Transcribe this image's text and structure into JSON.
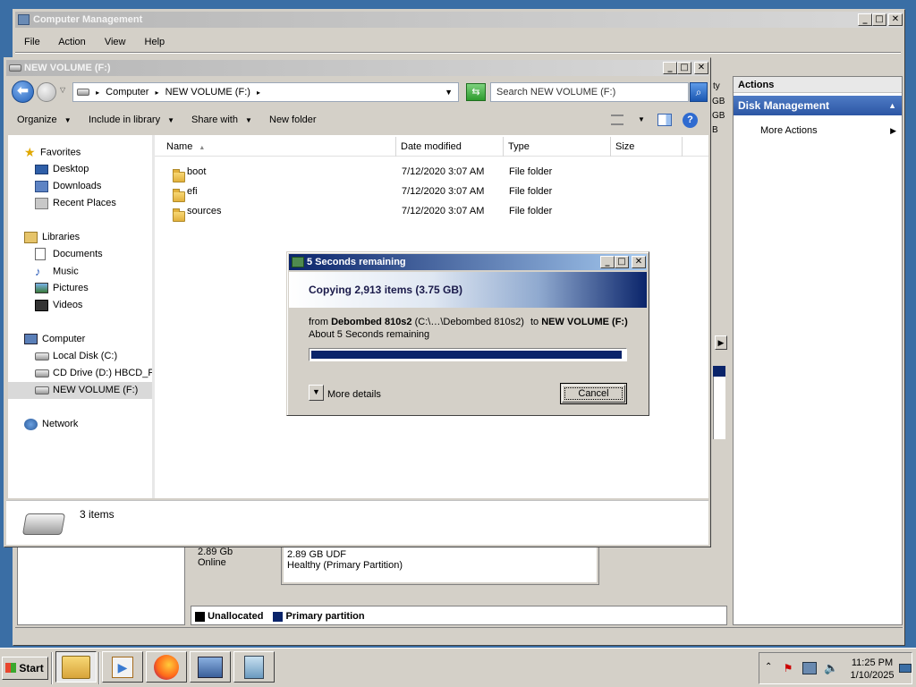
{
  "cm": {
    "title": "Computer Management",
    "menu": [
      "File",
      "Action",
      "View",
      "Help"
    ],
    "actions_title": "Actions",
    "disk_mgmt": "Disk Management",
    "more_actions": "More Actions",
    "volume_size": "2.89 GB UDF",
    "volume_status": "Healthy (Primary Partition)",
    "disk_size": "2.89 Gb",
    "disk_state": "Online",
    "legend_unalloc": "Unallocated",
    "legend_primary": "Primary partition",
    "partial_ty": "ty",
    "partial_gb1": "GB",
    "partial_gb2": "GB"
  },
  "explorer": {
    "title": "NEW VOLUME (F:)",
    "breadcrumb": [
      "Computer",
      "NEW VOLUME (F:)"
    ],
    "search_placeholder": "Search NEW VOLUME (F:)",
    "toolbar": {
      "organize": "Organize",
      "include": "Include in library",
      "share": "Share with",
      "new_folder": "New folder"
    },
    "columns": {
      "name": "Name",
      "date": "Date modified",
      "type": "Type",
      "size": "Size"
    },
    "files": [
      {
        "name": "boot",
        "date": "7/12/2020 3:07 AM",
        "type": "File folder",
        "size": ""
      },
      {
        "name": "efi",
        "date": "7/12/2020 3:07 AM",
        "type": "File folder",
        "size": ""
      },
      {
        "name": "sources",
        "date": "7/12/2020 3:07 AM",
        "type": "File folder",
        "size": ""
      }
    ],
    "nav": {
      "favorites": "Favorites",
      "desktop": "Desktop",
      "downloads": "Downloads",
      "recent": "Recent Places",
      "libraries": "Libraries",
      "documents": "Documents",
      "music": "Music",
      "pictures": "Pictures",
      "videos": "Videos",
      "computer": "Computer",
      "local_disk": "Local Disk (C:)",
      "cd_drive": "CD Drive (D:) HBCD_P",
      "new_volume": "NEW VOLUME (F:)",
      "network": "Network"
    },
    "status_count": "3 items"
  },
  "copy": {
    "title": "5 Seconds remaining",
    "header": "Copying 2,913 items (3.75 GB)",
    "from_label": "from",
    "from_name": "Debombed 810s2",
    "from_path": "(C:\\…\\Debombed 810s2)",
    "to_label": "to",
    "to_name": "NEW VOLUME (F:)",
    "remaining": "About 5 Seconds remaining",
    "progress": 0.99,
    "more_details": "More details",
    "cancel": "Cancel"
  },
  "taskbar": {
    "start": "Start",
    "time": "11:25 PM",
    "date": "1/10/2025"
  },
  "colors": {
    "title_active": "#0a246a",
    "progress": "#0a246a",
    "desktop": "#3a6ea5"
  }
}
